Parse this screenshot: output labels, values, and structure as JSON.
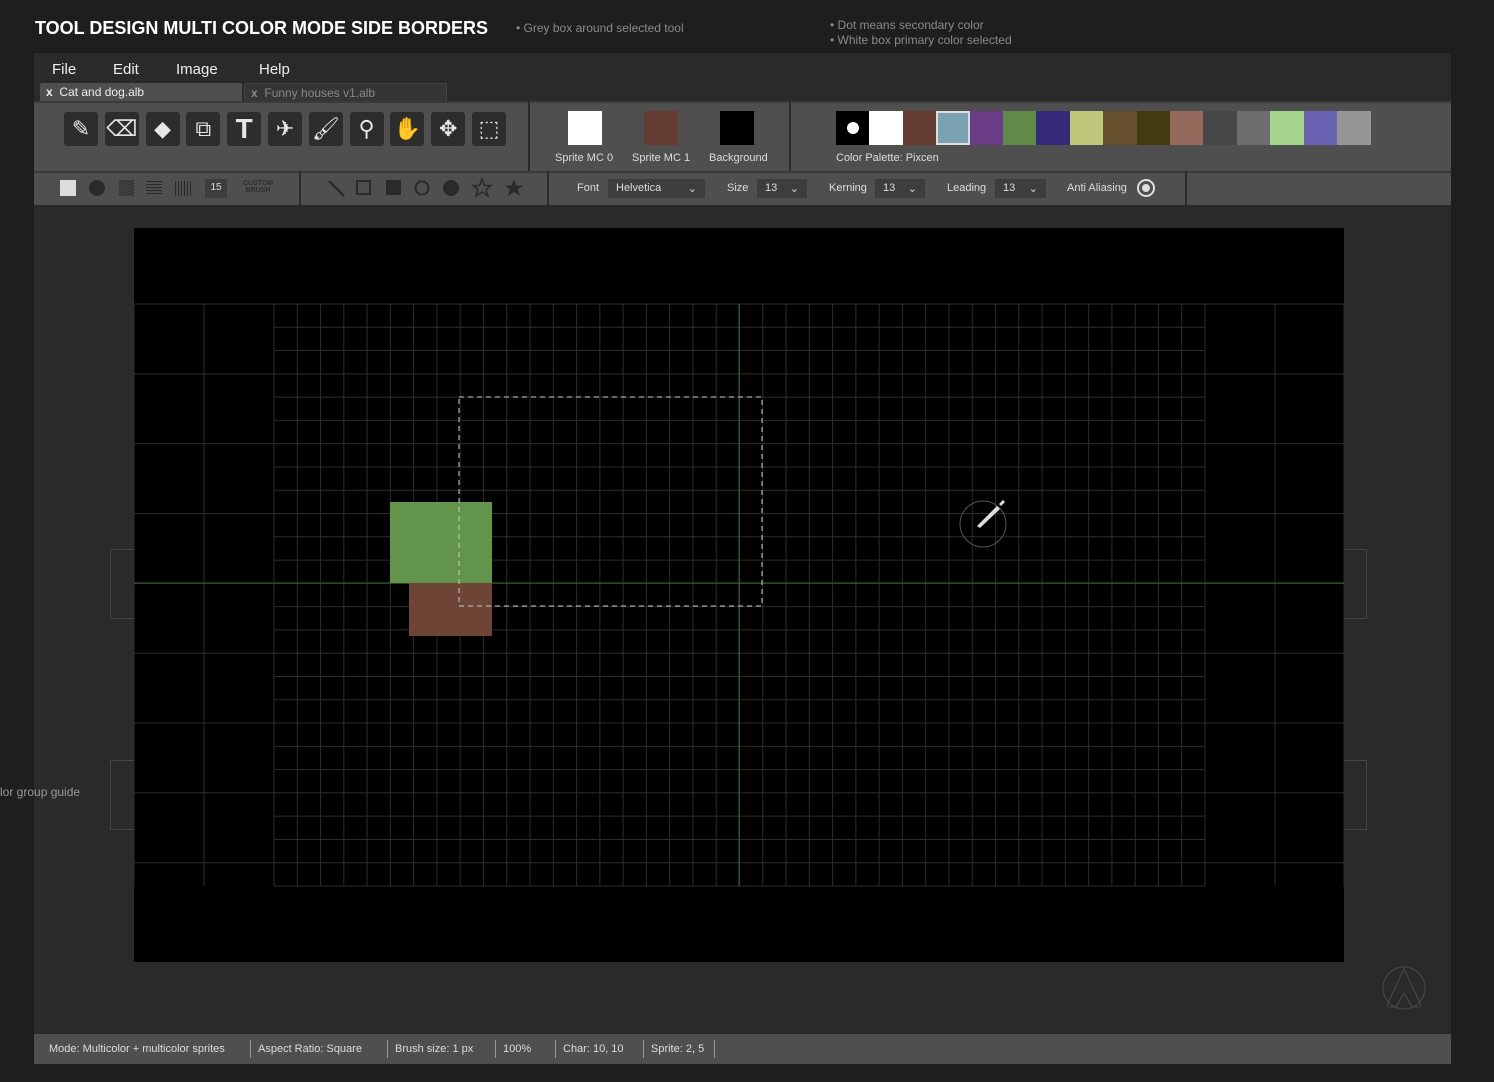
{
  "title": "TOOL DESIGN MULTI COLOR MODE SIDE BORDERS",
  "notes": [
    "Grey box around selected tool",
    "Dot means secondary color",
    "White box primary color selected"
  ],
  "side_note": "lor group guide",
  "menu": [
    "File",
    "Edit",
    "Image",
    "Help"
  ],
  "tabs": [
    {
      "label": "Cat and dog.alb",
      "active": true,
      "close": "x"
    },
    {
      "label": "Funny houses v1.alb",
      "active": false,
      "close": "x"
    }
  ],
  "tools": [
    "pencil-icon",
    "eraser-icon",
    "fill-bucket-icon",
    "shapes-icon",
    "text-icon",
    "spray-icon",
    "brush-icon",
    "eyedropper-icon",
    "hand-icon",
    "move-icon",
    "marquee-select-icon"
  ],
  "color_slots": [
    {
      "label": "Sprite MC 0",
      "color": "#ffffff"
    },
    {
      "label": "Sprite MC 1",
      "color": "#643c32"
    },
    {
      "label": "Background",
      "color": "#000000"
    }
  ],
  "palette": {
    "label": "Color Palette: Pixcen",
    "colors": [
      "#000000",
      "#ffffff",
      "#643c32",
      "#7aa2b2",
      "#6a3d86",
      "#5f8a49",
      "#342a78",
      "#bfc77a",
      "#664f2d",
      "#433a11",
      "#956a5d",
      "#474747",
      "#6d6d6d",
      "#a5d48d",
      "#6a62b2",
      "#959595"
    ],
    "secondary_index": 0,
    "primary_index": 3
  },
  "brush": {
    "size": "15",
    "custom_label": "CUSTOM BRUSH",
    "shapes": [
      "square-brush-icon",
      "circle-brush-icon",
      "dither-brush-icon",
      "horizontal-lines-brush-icon",
      "vertical-lines-brush-icon"
    ]
  },
  "shape_tools": [
    "line-icon",
    "rectangle-outline-icon",
    "rectangle-filled-icon",
    "circle-outline-icon",
    "circle-filled-icon",
    "star-outline-icon",
    "star-filled-icon"
  ],
  "text_options": {
    "font_label": "Font",
    "font": "Helvetica",
    "size_label": "Size",
    "size": "13",
    "kerning_label": "Kerning",
    "kerning": "13",
    "leading_label": "Leading",
    "leading": "13",
    "anti_alias_label": "Anti Aliasing",
    "anti_alias": true
  },
  "canvas": {
    "green_color": "#63944b",
    "brown_color": "#6e4436",
    "guide_color": "#2e6b2e"
  },
  "status": [
    "Mode: Multicolor + multicolor sprites",
    "Aspect Ratio: Square",
    "Brush size: 1 px",
    "100%",
    "Char: 10, 10",
    "Sprite: 2, 5"
  ]
}
